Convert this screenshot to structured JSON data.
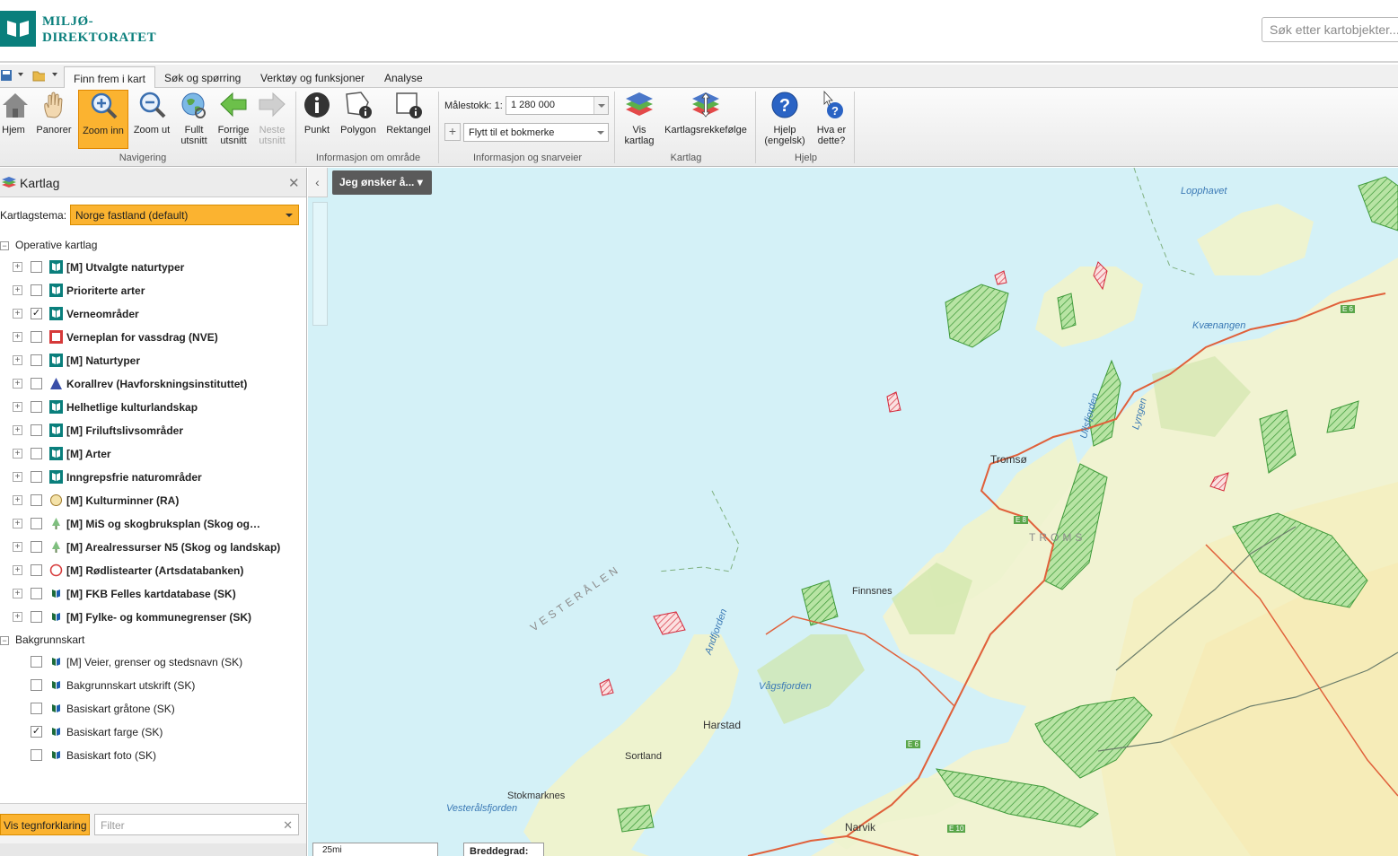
{
  "header": {
    "logo_line1": "MILJØ-",
    "logo_line2": "DIREKTORATET",
    "search_placeholder": "Søk etter kartobjekter..."
  },
  "tabs": [
    {
      "label": "Finn frem i kart",
      "active": true
    },
    {
      "label": "Søk og spørring"
    },
    {
      "label": "Verktøy og funksjoner"
    },
    {
      "label": "Analyse"
    }
  ],
  "ribbon": {
    "nav_buttons": [
      {
        "label": "Hjem",
        "icon": "home-icon"
      },
      {
        "label": "Panorer",
        "icon": "hand-pan-icon"
      },
      {
        "label": "Zoom inn",
        "icon": "zoom-in-icon",
        "active": true
      },
      {
        "label": "Zoom ut",
        "icon": "zoom-out-icon"
      },
      {
        "label": "Fullt\nutsnitt",
        "icon": "globe-icon"
      },
      {
        "label": "Forrige\nutsnitt",
        "icon": "arrow-left-icon"
      },
      {
        "label": "Neste\nutsnitt",
        "icon": "arrow-right-icon",
        "disabled": true
      }
    ],
    "nav_group": "Navigering",
    "info_buttons": [
      {
        "label": "Punkt",
        "icon": "info-point-icon"
      },
      {
        "label": "Polygon",
        "icon": "info-polygon-icon"
      },
      {
        "label": "Rektangel",
        "icon": "info-rectangle-icon"
      }
    ],
    "info_group": "Informasjon om område",
    "scale_label": "Målestokk: 1:",
    "scale_value": "1 280 000",
    "bookmark_value": "Flytt til et bokmerke",
    "shortcut_group": "Informasjon og snarveier",
    "layer_buttons": [
      {
        "label": "Vis\nkartlag",
        "icon": "layers-icon"
      },
      {
        "label": "Kartlagsrekkefølge",
        "icon": "layer-order-icon"
      }
    ],
    "layer_group": "Kartlag",
    "help_buttons": [
      {
        "label": "Hjelp\n(engelsk)",
        "icon": "help-icon"
      },
      {
        "label": "Hva er\ndette?",
        "icon": "whats-this-icon"
      }
    ],
    "help_group": "Hjelp"
  },
  "panel": {
    "title": "Kartlag",
    "tema_label": "Kartlagstema:",
    "tema_value": "Norge fastland (default)",
    "operative_label": "Operative kartlag",
    "operative_layers": [
      {
        "name": "[M] Utvalgte naturtyper",
        "checked": false,
        "icon": "md-icon"
      },
      {
        "name": "Prioriterte arter",
        "checked": false,
        "icon": "md-icon"
      },
      {
        "name": "Verneområder",
        "checked": true,
        "icon": "md-icon"
      },
      {
        "name": "Verneplan for vassdrag (NVE)",
        "checked": false,
        "icon": "nve-icon"
      },
      {
        "name": "[M] Naturtyper",
        "checked": false,
        "icon": "md-icon"
      },
      {
        "name": "Korallrev (Havforskningsinstituttet)",
        "checked": false,
        "icon": "coral-icon"
      },
      {
        "name": "Helhetlige kulturlandskap",
        "checked": false,
        "icon": "md-icon"
      },
      {
        "name": "[M] Friluftslivsområder",
        "checked": false,
        "icon": "md-icon"
      },
      {
        "name": "[M] Arter",
        "checked": false,
        "icon": "md-icon"
      },
      {
        "name": "Inngrepsfrie naturområder",
        "checked": false,
        "icon": "md-icon"
      },
      {
        "name": "[M] Kulturminner (RA)",
        "checked": false,
        "icon": "ra-icon"
      },
      {
        "name": "[M] MiS og skogbruksplan (Skog og…",
        "checked": false,
        "icon": "tree-icon"
      },
      {
        "name": "[M] Arealressurser N5 (Skog og landskap)",
        "checked": false,
        "icon": "tree-icon"
      },
      {
        "name": "[M] Rødlistearter (Artsdatabanken)",
        "checked": false,
        "icon": "redlist-icon"
      },
      {
        "name": "[M] FKB Felles kartdatabase (SK)",
        "checked": false,
        "icon": "sk-icon"
      },
      {
        "name": "[M] Fylke- og kommunegrenser (SK)",
        "checked": false,
        "icon": "sk-icon"
      }
    ],
    "background_label": "Bakgrunnskart",
    "background_layers": [
      {
        "name": "[M] Veier, grenser og stedsnavn (SK)",
        "checked": false
      },
      {
        "name": "Bakgrunnskart utskrift (SK)",
        "checked": false
      },
      {
        "name": "Basiskart gråtone (SK)",
        "checked": false
      },
      {
        "name": "Basiskart farge (SK)",
        "checked": true
      },
      {
        "name": "Basiskart foto (SK)",
        "checked": false
      }
    ],
    "legend_button": "Vis tegnforklaring",
    "filter_placeholder": "Filter"
  },
  "map": {
    "jeg_onsker": "Jeg ønsker å...",
    "labels": {
      "lopphavet": "Lopphavet",
      "kvaenangen": "Kvænangen",
      "tromso": "Tromsø",
      "troms": "TROMS",
      "finnsnes": "Finnsnes",
      "vesteralen": "VESTERÅLEN",
      "andfjorden": "Andfjorden",
      "vagsfjorden": "Vågsfjorden",
      "harstad": "Harstad",
      "sortland": "Sortland",
      "stokmarknes": "Stokmarknes",
      "vesteralsfjorden": "Vesterålsfjorden",
      "narvik": "Narvik",
      "lyngen": "Lyngen",
      "ullsfjorden": "Ullsfjorden",
      "e6": "E 6",
      "e8": "E 8",
      "e10": "E 10"
    },
    "scalebar": "25mi",
    "coord_label": "Breddegrad:"
  },
  "colors": {
    "brand": "#0a7f7c",
    "accent": "#fbb330",
    "water": "#d4f1f7",
    "land": "#eef2d6",
    "protected": "#3fa83f",
    "road": "#e0603a"
  }
}
